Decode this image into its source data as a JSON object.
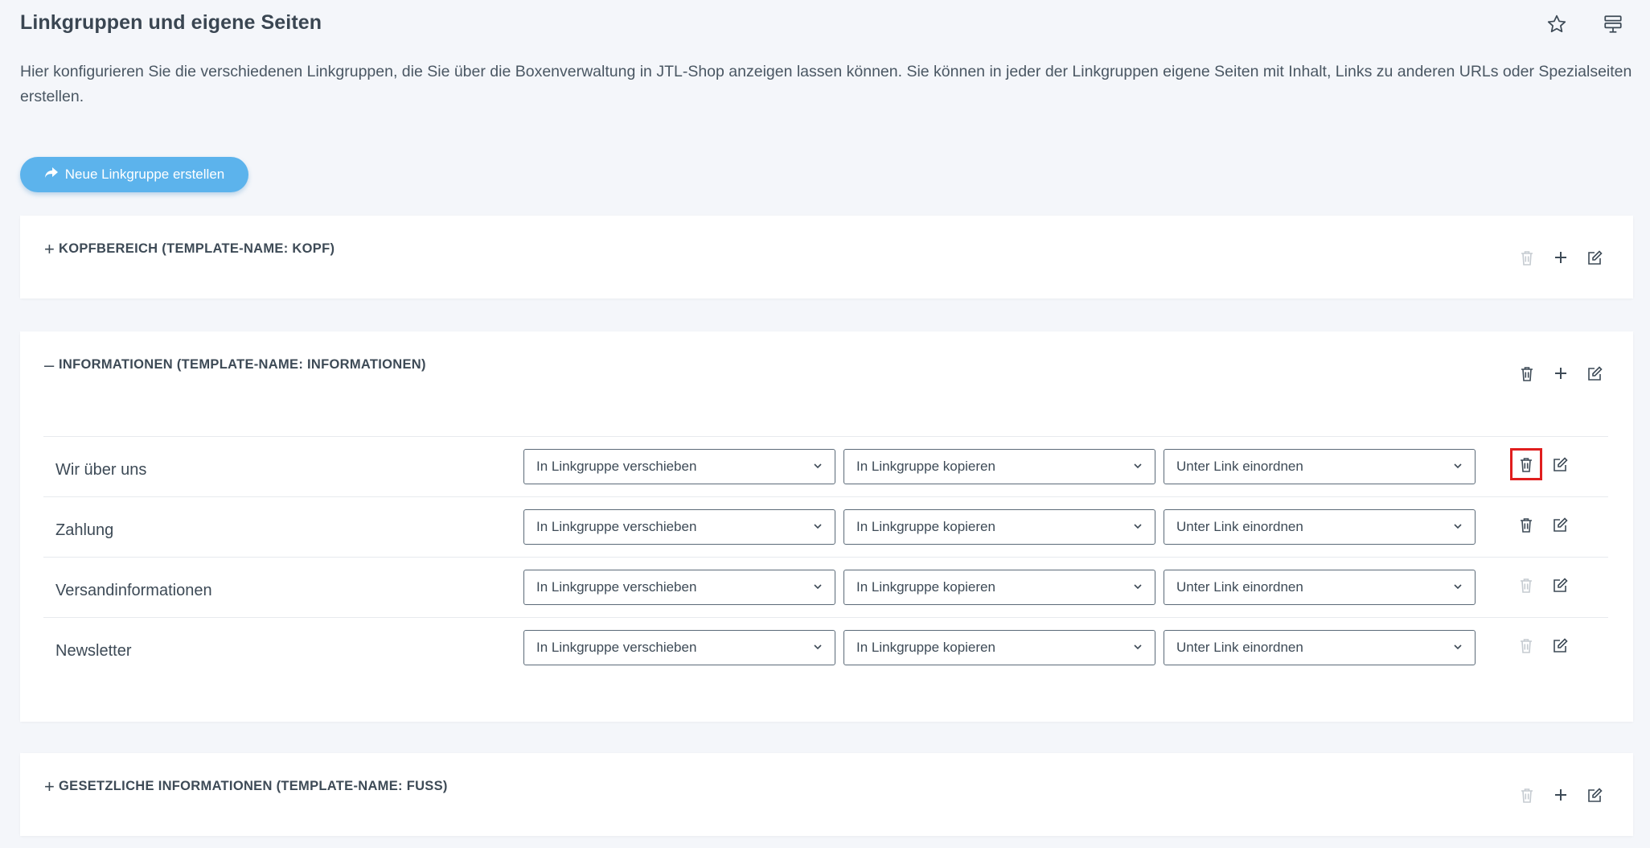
{
  "page": {
    "title": "Linkgruppen und eigene Seiten",
    "intro": "Hier konfigurieren Sie die verschiedenen Linkgruppen, die Sie über die Boxenverwaltung in JTL-Shop anzeigen lassen können. Sie können in jeder der Linkgruppen eigene Seiten mit Inhalt, Links zu anderen URLs oder Spezialseiten erstellen.",
    "new_button": "Neue Linkgruppe erstellen"
  },
  "icons": {
    "favorite": "star-icon",
    "layout": "layout-icon",
    "delete": "trash-icon",
    "add": "plus-icon",
    "edit": "edit-icon",
    "share": "share-icon",
    "dropdown": "chevron-down-icon"
  },
  "colors": {
    "accent": "#5cb3ec",
    "highlight": "#e01e1e",
    "icon": "#3d4a56",
    "icon_disabled": "#c5cbd1"
  },
  "groups": [
    {
      "toggle": "+",
      "title": "KOPFBEREICH (TEMPLATE-NAME: KOPF)",
      "expanded": false,
      "delete_enabled": false
    },
    {
      "toggle": "–",
      "title": "INFORMATIONEN (TEMPLATE-NAME: INFORMATIONEN)",
      "expanded": true,
      "delete_enabled": true,
      "links": [
        {
          "name": "Wir über uns",
          "move": "In Linkgruppe verschieben",
          "copy": "In Linkgruppe kopieren",
          "parent": "Unter Link einordnen",
          "delete_enabled": true,
          "delete_highlighted": true
        },
        {
          "name": "Zahlung",
          "move": "In Linkgruppe verschieben",
          "copy": "In Linkgruppe kopieren",
          "parent": "Unter Link einordnen",
          "delete_enabled": true,
          "delete_highlighted": false
        },
        {
          "name": "Versandinformationen",
          "move": "In Linkgruppe verschieben",
          "copy": "In Linkgruppe kopieren",
          "parent": "Unter Link einordnen",
          "delete_enabled": false,
          "delete_highlighted": false
        },
        {
          "name": "Newsletter",
          "move": "In Linkgruppe verschieben",
          "copy": "In Linkgruppe kopieren",
          "parent": "Unter Link einordnen",
          "delete_enabled": false,
          "delete_highlighted": false
        }
      ]
    },
    {
      "toggle": "+",
      "title": "GESETZLICHE INFORMATIONEN (TEMPLATE-NAME: FUSS)",
      "expanded": false,
      "delete_enabled": false
    }
  ]
}
